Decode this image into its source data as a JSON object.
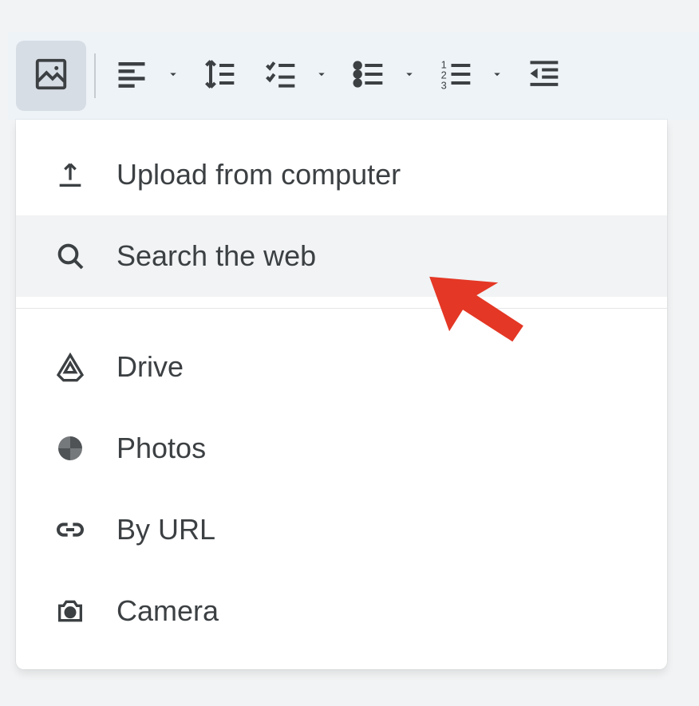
{
  "toolbar": {
    "insert_image": "Insert image",
    "align": "Align",
    "line_spacing": "Line & paragraph spacing",
    "checklist": "Checklist",
    "bulleted_list": "Bulleted list",
    "numbered_list": "Numbered list",
    "decrease_indent": "Decrease indent"
  },
  "menu": {
    "items": [
      {
        "label": "Upload from computer",
        "icon": "upload-icon"
      },
      {
        "label": "Search the web",
        "icon": "search-icon",
        "hovered": true
      },
      {
        "divider": true
      },
      {
        "label": "Drive",
        "icon": "drive-icon"
      },
      {
        "label": "Photos",
        "icon": "photos-icon"
      },
      {
        "label": "By URL",
        "icon": "link-icon"
      },
      {
        "label": "Camera",
        "icon": "camera-icon"
      }
    ]
  },
  "annotation": {
    "cursor_color": "#e43725"
  }
}
